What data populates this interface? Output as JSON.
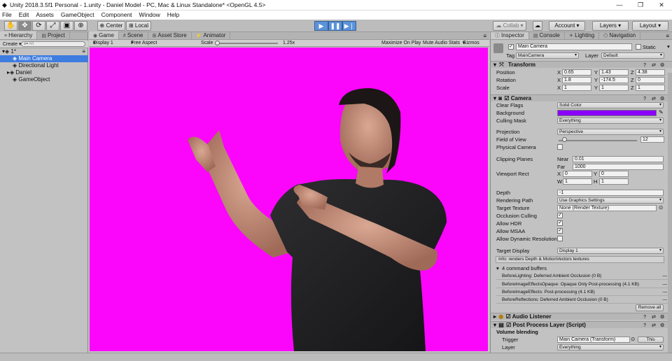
{
  "window": {
    "title": "Unity 2018.3.5f1 Personal - 1.unity - Daniel Model - PC, Mac & Linux Standalone* <OpenGL 4.5>"
  },
  "menu": [
    "File",
    "Edit",
    "Assets",
    "GameObject",
    "Component",
    "Window",
    "Help"
  ],
  "toolbar": {
    "pivot": "Center",
    "space": "Local",
    "collab": "Collab",
    "account": "Account",
    "layers": "Layers",
    "layout": "Layout"
  },
  "hierarchy": {
    "tabs": [
      "Hierarchy",
      "Project"
    ],
    "create": "Create",
    "search_placeholder": "All",
    "scene": "1*",
    "items": [
      "Main Camera",
      "Directional Light",
      "Daniel",
      "GameObject"
    ]
  },
  "game": {
    "tabs": [
      "Game",
      "Scene",
      "Asset Store",
      "Animator"
    ],
    "display": "Display 1",
    "aspect": "Free Aspect",
    "scale_label": "Scale",
    "scale_value": "1.25x",
    "options": [
      "Maximize On Play",
      "Mute Audio",
      "Stats",
      "Gizmos"
    ],
    "background_color": "#fb05fb"
  },
  "inspector": {
    "tabs": [
      "Inspector",
      "Console",
      "Lighting",
      "Navigation"
    ],
    "object_name": "Main Camera",
    "static_label": "Static",
    "tag_label": "Tag",
    "tag": "MainCamera",
    "layer_label": "Layer",
    "layer": "Default",
    "transform": {
      "title": "Transform",
      "rows": [
        {
          "label": "Position",
          "x": "0.65",
          "y": "1.43",
          "z": "4.38"
        },
        {
          "label": "Rotation",
          "x": "1.8",
          "y": "-174.5",
          "z": "0"
        },
        {
          "label": "Scale",
          "x": "1",
          "y": "1",
          "z": "1"
        }
      ]
    },
    "camera": {
      "title": "Camera",
      "clear_flags_label": "Clear Flags",
      "clear_flags": "Solid Color",
      "background_label": "Background",
      "background_color": "#8b00f8",
      "culling_mask_label": "Culling Mask",
      "culling_mask": "Everything",
      "projection_label": "Projection",
      "projection": "Perspective",
      "fov_label": "Field of View",
      "fov": "12",
      "physical_label": "Physical Camera",
      "clipping_label": "Clipping Planes",
      "near_label": "Near",
      "near": "0.01",
      "far_label": "Far",
      "far": "1000",
      "viewport_label": "Viewport Rect",
      "vx": "0",
      "vy": "0",
      "vw": "1",
      "vh": "1",
      "depth_label": "Depth",
      "depth": "-1",
      "render_path_label": "Rendering Path",
      "render_path": "Use Graphics Settings",
      "target_texture_label": "Target Texture",
      "target_texture": "None (Render Texture)",
      "occlusion_label": "Occlusion Culling",
      "hdr_label": "Allow HDR",
      "msaa_label": "Allow MSAA",
      "dyn_res_label": "Allow Dynamic Resolution",
      "target_display_label": "Target Display",
      "target_display": "Display 1",
      "info": "Info: renders Depth & MotionVectors textures",
      "cmd_header": "4 command buffers",
      "commands": [
        "BeforeLighting: Deferred Ambient Occlusion (0 B)",
        "BeforeImageEffectsOpaque: Opaque Only Post-processing (4.1 KB)",
        "BeforeImageEffects: Post-processing (4.1 KB)",
        "BeforeReflections: Deferred Ambient Occlusion (0 B)"
      ],
      "remove_all": "Remove all"
    },
    "audio_listener": "Audio Listener",
    "post_process": {
      "title": "Post Process Layer (Script)",
      "volume_blending": "Volume blending",
      "trigger_label": "Trigger",
      "trigger": "Main Camera (Transform)",
      "this": "This",
      "layer_label": "Layer",
      "layer": "Everything"
    }
  }
}
